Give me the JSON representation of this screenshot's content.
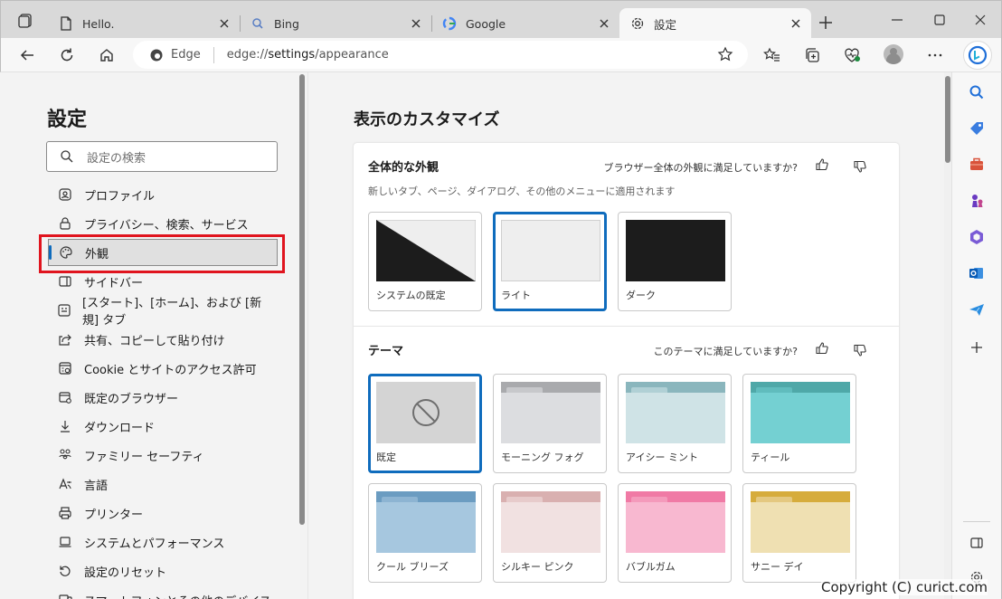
{
  "tabs": [
    {
      "title": "Hello.",
      "icon": "page-icon"
    },
    {
      "title": "Bing",
      "icon": "search-icon"
    },
    {
      "title": "Google",
      "icon": "google-icon"
    },
    {
      "title": "設定",
      "icon": "gear-icon",
      "active": true
    }
  ],
  "address": {
    "site": "Edge",
    "url_prefix": "edge://",
    "url_main": "settings",
    "url_suffix": "/appearance"
  },
  "settings_nav": {
    "title": "設定",
    "search_placeholder": "設定の検索",
    "items": [
      {
        "label": "プロファイル",
        "icon": "profile-icon"
      },
      {
        "label": "プライバシー、検索、サービス",
        "icon": "lock-icon"
      },
      {
        "label": "外観",
        "icon": "palette-icon",
        "selected": true
      },
      {
        "label": "サイドバー",
        "icon": "sidebar-icon"
      },
      {
        "label": "[スタート]、[ホーム]、および [新規] タブ",
        "icon": "home-tab-icon"
      },
      {
        "label": "共有、コピーして貼り付け",
        "icon": "share-icon"
      },
      {
        "label": "Cookie とサイトのアクセス許可",
        "icon": "cookie-icon"
      },
      {
        "label": "既定のブラウザー",
        "icon": "browser-icon"
      },
      {
        "label": "ダウンロード",
        "icon": "download-icon"
      },
      {
        "label": "ファミリー セーフティ",
        "icon": "family-icon"
      },
      {
        "label": "言語",
        "icon": "language-icon"
      },
      {
        "label": "プリンター",
        "icon": "printer-icon"
      },
      {
        "label": "システムとパフォーマンス",
        "icon": "system-icon"
      },
      {
        "label": "設定のリセット",
        "icon": "reset-icon"
      },
      {
        "label": "スマートフォンとその他のデバイス",
        "icon": "phone-icon"
      }
    ]
  },
  "main": {
    "heading": "表示のカスタマイズ",
    "overall": {
      "title": "全体的な外観",
      "subtitle": "新しいタブ、ページ、ダイアログ、その他のメニューに適用されます",
      "feedback": "ブラウザー全体の外観に満足していますか?",
      "options": [
        {
          "label": "システムの既定"
        },
        {
          "label": "ライト",
          "selected": true
        },
        {
          "label": "ダーク"
        }
      ]
    },
    "theme": {
      "title": "テーマ",
      "feedback": "このテーマに満足していますか?",
      "options": [
        {
          "label": "既定",
          "selected": true
        },
        {
          "label": "モーニング フォグ",
          "tab": "#a9aaad",
          "body": "#dcdde0",
          "back": "#c7c8cb"
        },
        {
          "label": "アイシー ミント",
          "tab": "#8ab6bd",
          "body": "#cfe3e6",
          "back": "#b0d0d5"
        },
        {
          "label": "ティール",
          "tab": "#4fa8a8",
          "body": "#74d0d2",
          "back": "#60bcbd"
        },
        {
          "label": "クール ブリーズ",
          "tab": "#6b9cc1",
          "body": "#a6c7df",
          "back": "#8db4d2"
        },
        {
          "label": "シルキー ピンク",
          "tab": "#d9b0b0",
          "body": "#f1e1e1",
          "back": "#e7cbcb"
        },
        {
          "label": "バブルガム",
          "tab": "#f07aa5",
          "body": "#f8b8d0",
          "back": "#f49abb"
        },
        {
          "label": "サニー デイ",
          "tab": "#d6ac3c",
          "body": "#efe0b2",
          "back": "#e4c880"
        }
      ]
    }
  },
  "watermark": "Copyright (C) curict.com",
  "colors": {
    "accent": "#0f6cbd",
    "highlight": "#e0141e"
  }
}
